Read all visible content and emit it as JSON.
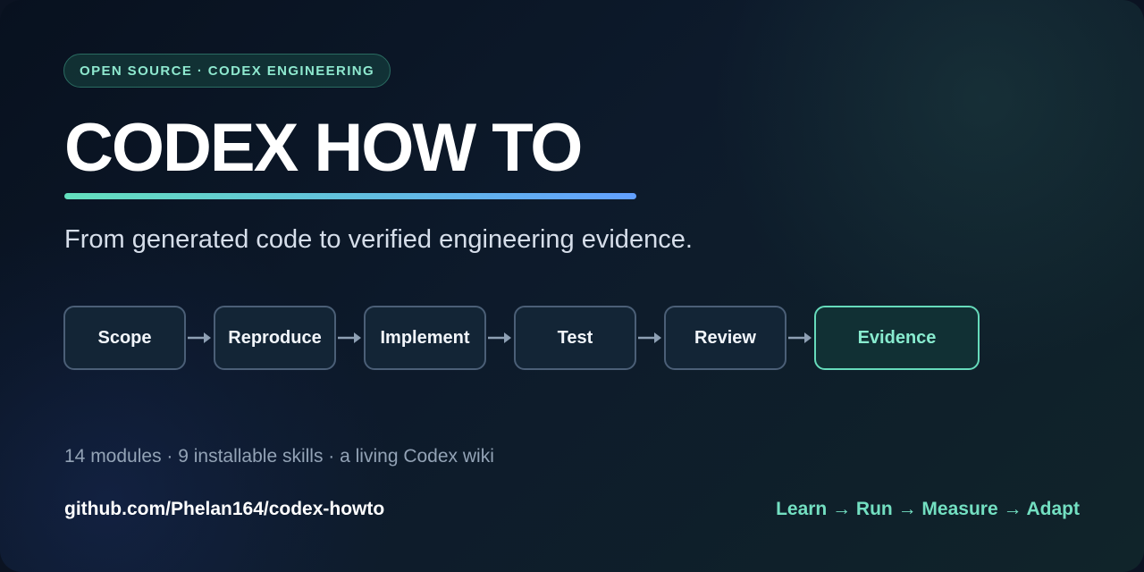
{
  "badge": "OPEN SOURCE · CODEX ENGINEERING",
  "title": "CODEX HOW TO",
  "subtitle": "From generated code to verified engineering evidence.",
  "steps": [
    "Scope",
    "Reproduce",
    "Implement",
    "Test",
    "Review",
    "Evidence"
  ],
  "stats": "14 modules · 9 installable skills · a living Codex wiki",
  "repo": "github.com/Phelan164/codex-howto",
  "motto": "Learn → Run → Measure → Adapt",
  "colors": {
    "accent": "#73dfc1",
    "gradient_start": "#63e0bd",
    "gradient_end": "#62a0ff",
    "background": "#0b1322"
  },
  "icons": [
    "arrow-right-icon"
  ]
}
